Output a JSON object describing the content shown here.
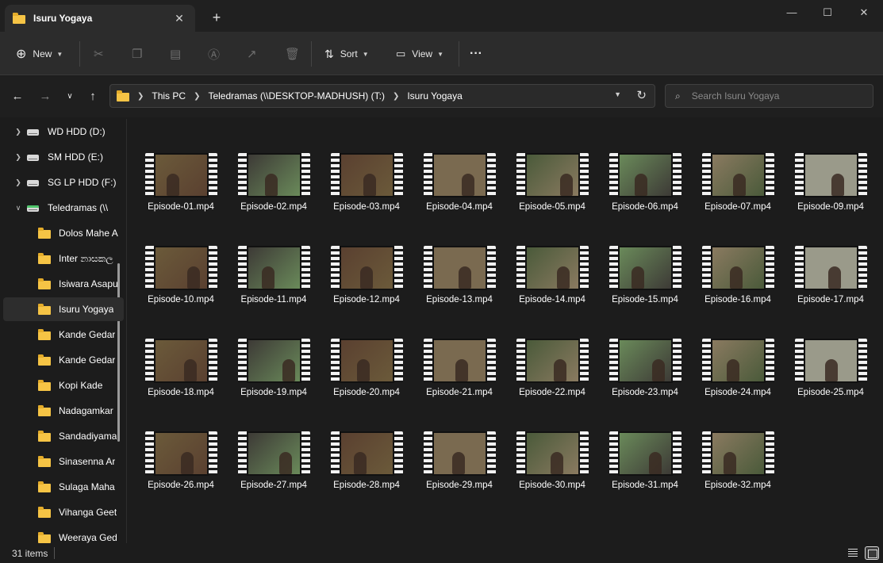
{
  "window": {
    "tab_title": "Isuru Yogaya",
    "minimize": "—",
    "maximize": "☐",
    "close": "✕",
    "new_tab": "+"
  },
  "toolbar": {
    "new_label": "New",
    "sort_label": "Sort",
    "view_label": "View",
    "more": "···"
  },
  "address": {
    "crumbs": [
      "This PC",
      "Teledramas (\\\\DESKTOP-MADHUSH) (T:)",
      "Isuru Yogaya"
    ],
    "search_placeholder": "Search Isuru Yogaya"
  },
  "sidebar": {
    "items": [
      {
        "label": "WD HDD (D:)",
        "type": "drive"
      },
      {
        "label": "SM HDD (E:)",
        "type": "drive"
      },
      {
        "label": "SG LP HDD (F:)",
        "type": "drive"
      },
      {
        "label": "Teledramas (\\\\",
        "type": "netdrive"
      },
      {
        "label": "Dolos Mahe A",
        "type": "folder"
      },
      {
        "label": "Inter නාසකල",
        "type": "folder"
      },
      {
        "label": "Isiwara Asapu",
        "type": "folder"
      },
      {
        "label": "Isuru Yogaya",
        "type": "folder"
      },
      {
        "label": "Kande Gedar",
        "type": "folder"
      },
      {
        "label": "Kande Gedar",
        "type": "folder"
      },
      {
        "label": "Kopi Kade",
        "type": "folder"
      },
      {
        "label": "Nadagamkar",
        "type": "folder"
      },
      {
        "label": "Sandadiyama",
        "type": "folder"
      },
      {
        "label": "Sinasenna Ar",
        "type": "folder"
      },
      {
        "label": "Sulaga Maha",
        "type": "folder"
      },
      {
        "label": "Vihanga Geet",
        "type": "folder"
      },
      {
        "label": "Weeraya Ged",
        "type": "folder"
      }
    ]
  },
  "files": [
    {
      "name": "Episode-01.mp4"
    },
    {
      "name": "Episode-02.mp4"
    },
    {
      "name": "Episode-03.mp4"
    },
    {
      "name": "Episode-04.mp4"
    },
    {
      "name": "Episode-05.mp4"
    },
    {
      "name": "Episode-06.mp4"
    },
    {
      "name": "Episode-07.mp4"
    },
    {
      "name": "Episode-09.mp4"
    },
    {
      "name": "Episode-10.mp4"
    },
    {
      "name": "Episode-11.mp4"
    },
    {
      "name": "Episode-12.mp4"
    },
    {
      "name": "Episode-13.mp4"
    },
    {
      "name": "Episode-14.mp4"
    },
    {
      "name": "Episode-15.mp4"
    },
    {
      "name": "Episode-16.mp4"
    },
    {
      "name": "Episode-17.mp4"
    },
    {
      "name": "Episode-18.mp4"
    },
    {
      "name": "Episode-19.mp4"
    },
    {
      "name": "Episode-20.mp4"
    },
    {
      "name": "Episode-21.mp4"
    },
    {
      "name": "Episode-22.mp4"
    },
    {
      "name": "Episode-23.mp4"
    },
    {
      "name": "Episode-24.mp4"
    },
    {
      "name": "Episode-25.mp4"
    },
    {
      "name": "Episode-26.mp4"
    },
    {
      "name": "Episode-27.mp4"
    },
    {
      "name": "Episode-28.mp4"
    },
    {
      "name": "Episode-29.mp4"
    },
    {
      "name": "Episode-30.mp4"
    },
    {
      "name": "Episode-31.mp4"
    },
    {
      "name": "Episode-32.mp4"
    }
  ],
  "status": {
    "item_count": "31 items"
  },
  "colors": {
    "folder": "#f6c445",
    "background": "#1c1c1c",
    "thumb_tones": [
      "#6b5a3a",
      "#3d3a36",
      "#5a4030",
      "#7a6a50",
      "#4a5a3a",
      "#6a8a5a",
      "#8a7a60",
      "#9a9a8a"
    ]
  }
}
